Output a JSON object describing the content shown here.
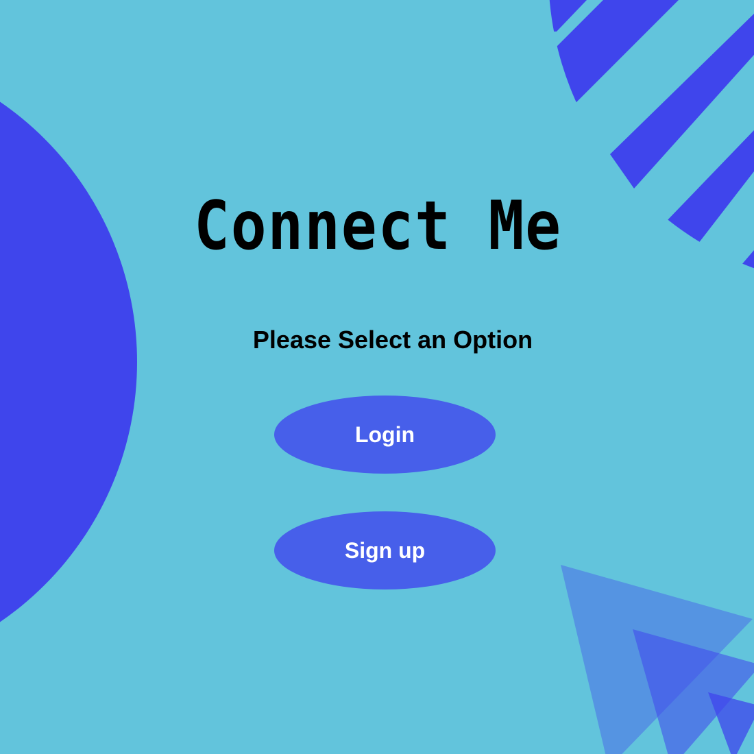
{
  "app": {
    "title": "Connect Me",
    "prompt": "Please Select an Option"
  },
  "actions": {
    "login_label": "Login",
    "signup_label": "Sign up"
  },
  "colors": {
    "background": "#62C4DC",
    "shape_blue": "#3F45EC",
    "button_fill": "#475FEA",
    "triangle_fill": "#4B6EE8",
    "button_text": "#FFFFFF",
    "title_text": "#000000"
  }
}
